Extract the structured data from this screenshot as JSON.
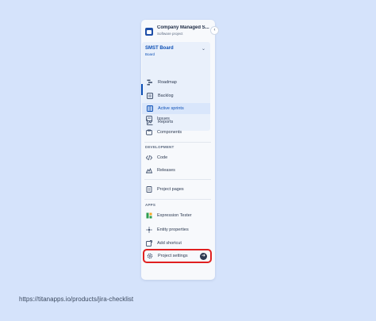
{
  "project": {
    "name": "Company Managed S...",
    "type": "Software project"
  },
  "board": {
    "title": "SMST Board",
    "subtitle": "Board",
    "items": [
      {
        "label": "Roadmap",
        "icon": "roadmap-icon"
      },
      {
        "label": "Backlog",
        "icon": "backlog-icon"
      },
      {
        "label": "Active sprints",
        "icon": "active-sprints-icon",
        "active": true
      },
      {
        "label": "Reports",
        "icon": "reports-icon"
      }
    ]
  },
  "nav": {
    "issues": "Issues",
    "components": "Components"
  },
  "development": {
    "heading": "DEVELOPMENT",
    "code": "Code",
    "releases": "Releases"
  },
  "project_pages": "Project pages",
  "apps": {
    "heading": "APPS",
    "expression_tester": "Expression Tester",
    "entity_properties": "Entity properties",
    "add_shortcut": "Add shortcut"
  },
  "settings": {
    "label": "Project settings"
  },
  "footer": {
    "url": "https://titanapps.io/products/jira-checklist"
  },
  "colors": {
    "accent": "#0c4fb5",
    "highlight_border": "#e02020",
    "background": "#d5e3fb"
  }
}
